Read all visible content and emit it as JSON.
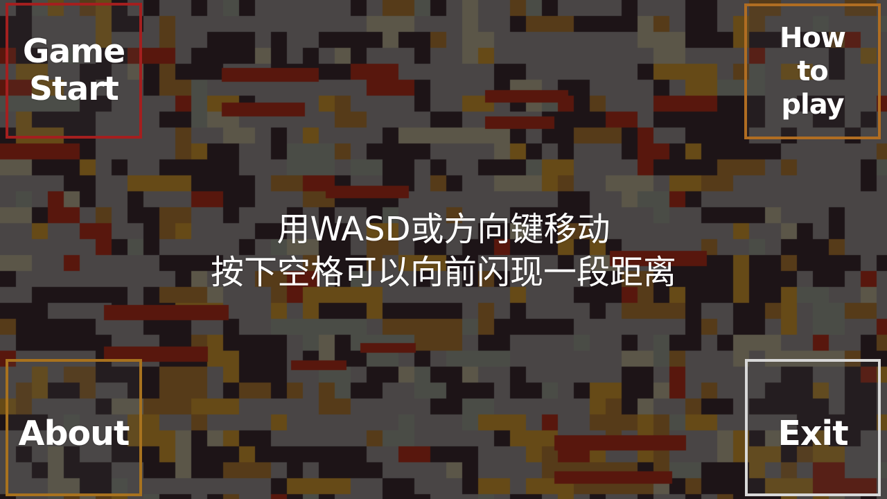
{
  "menu": {
    "start_label": "Game\nStart",
    "howto_label": "How\nto\nplay",
    "about_label": "About",
    "exit_label": "Exit"
  },
  "instructions": {
    "line1": "用WASD或方向键移动",
    "line2": "按下空格可以向前闪现一段距离"
  },
  "colors": {
    "start_border": "#a41f1f",
    "howto_border": "#b06d22",
    "about_border": "#a8721e",
    "exit_border": "#d8d8d8",
    "text": "#ffffff",
    "tile_palette": [
      "#4b4747",
      "#1a1014",
      "#5a3b16",
      "#6b4c14",
      "#5c1408",
      "#4c4f48",
      "#5f5a4a"
    ]
  },
  "background": {
    "description_icon": "pixel-tile-map"
  }
}
